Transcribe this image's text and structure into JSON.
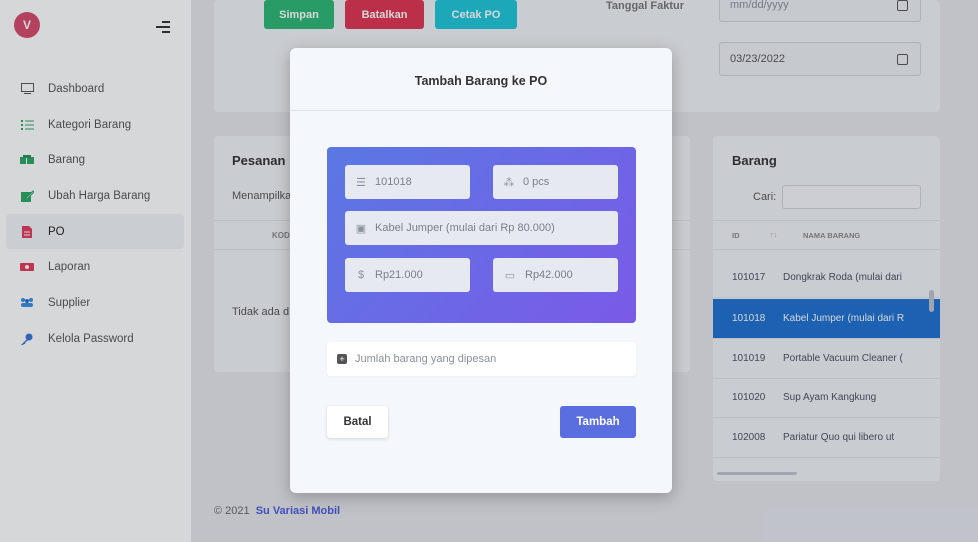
{
  "sidebar": {
    "brand_letter": "V",
    "items": [
      {
        "label": "Dashboard",
        "icon": "monitor-icon"
      },
      {
        "label": "Kategori Barang",
        "icon": "list-icon"
      },
      {
        "label": "Barang",
        "icon": "boxes-icon"
      },
      {
        "label": "Ubah Harga Barang",
        "icon": "edit-icon"
      },
      {
        "label": "PO",
        "icon": "document-icon"
      },
      {
        "label": "Laporan",
        "icon": "money-icon"
      },
      {
        "label": "Supplier",
        "icon": "users-icon"
      },
      {
        "label": "Kelola Password",
        "icon": "key-icon"
      }
    ],
    "active_index": 4
  },
  "header": {
    "btn_simpan": "Simpan",
    "btn_batalkan": "Batalkan",
    "btn_cetak": "Cetak PO",
    "tanggal_label": "Tanggal Faktur",
    "tanggal_placeholder": "mm/dd/yyyy",
    "tanggal_value": "03/23/2022"
  },
  "pesanan": {
    "title": "Pesanan",
    "info": "Menampilka",
    "col_kode": "KOD",
    "empty_text": "Tidak ada d"
  },
  "barang": {
    "title": "Barang",
    "search_label": "Cari:",
    "col_id": "ID",
    "col_sort": "↑↓",
    "col_nama": "NAMA BARANG",
    "rows": [
      {
        "id": "101017",
        "nama": "Dongkrak Roda (mulai dari"
      },
      {
        "id": "101018",
        "nama": "Kabel Jumper (mulai dari R"
      },
      {
        "id": "101019",
        "nama": "Portable Vacuum Cleaner ("
      },
      {
        "id": "101020",
        "nama": "Sup Ayam Kangkung"
      },
      {
        "id": "102008",
        "nama": "Pariatur Quo qui libero ut"
      }
    ],
    "selected_index": 1
  },
  "modal": {
    "title": "Tambah Barang ke PO",
    "kode": "101018",
    "stok": "0 pcs",
    "nama": "Kabel Jumper (mulai dari Rp 80.000)",
    "harga": "Rp21.000",
    "total": "Rp42.000",
    "qty_placeholder": "Jumlah barang yang dipesan",
    "btn_batal": "Batal",
    "btn_tambah": "Tambah"
  },
  "footer": {
    "copyright": "© 2021",
    "brand": "Su Variasi Mobil"
  },
  "colors": {
    "accent": "#5a6ee0",
    "green": "#2bb673",
    "red": "#e0334f",
    "cyan": "#1ec6d9",
    "selected_row": "#1e6fd0"
  }
}
